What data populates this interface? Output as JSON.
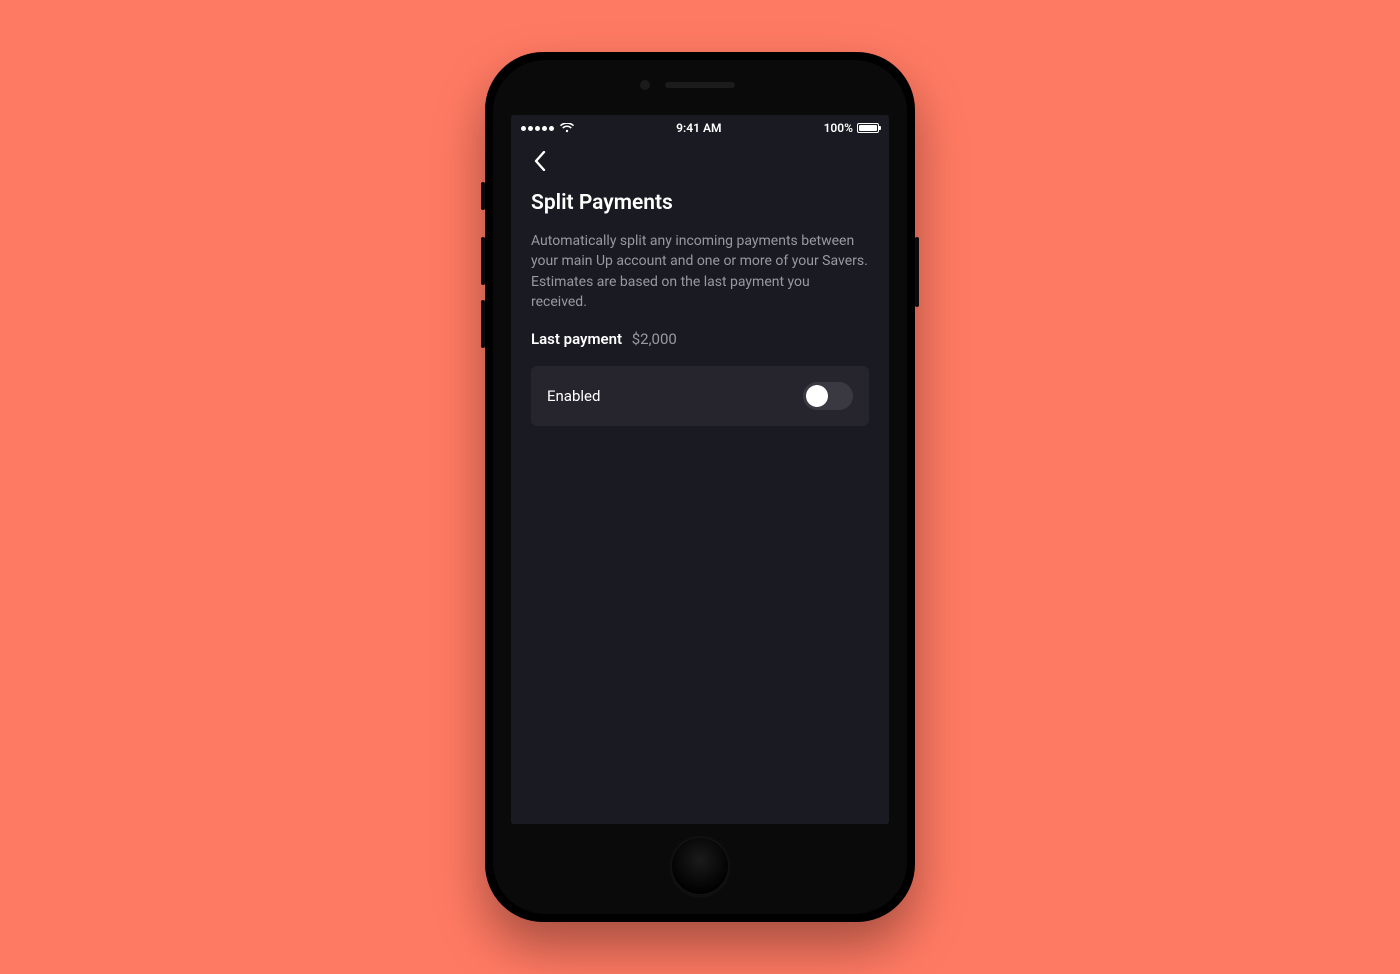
{
  "statusBar": {
    "time": "9:41 AM",
    "batteryText": "100%"
  },
  "page": {
    "title": "Split Payments",
    "description": "Automatically split any incoming payments between your main Up account and one or more of your Savers. Estimates are based on the last payment you received.",
    "lastPaymentLabel": "Last payment",
    "lastPaymentValue": "$2,000"
  },
  "toggle": {
    "label": "Enabled",
    "state": "off"
  }
}
